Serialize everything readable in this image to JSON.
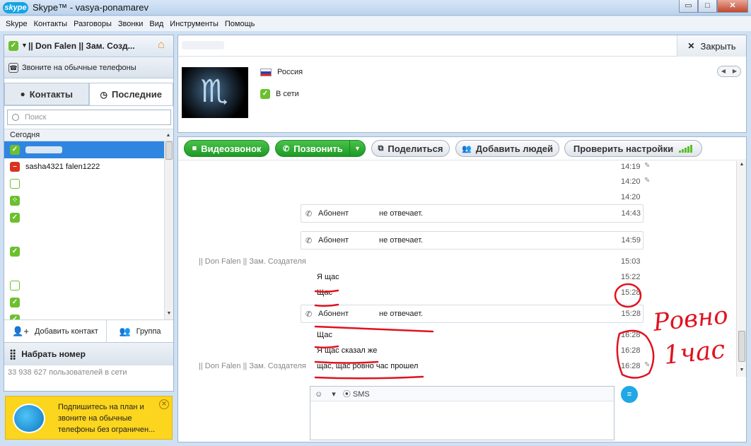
{
  "window": {
    "logo": "skype",
    "title": "Skype™ - vasya-ponamarev",
    "buttons": [
      "restore",
      "maximize",
      "close"
    ]
  },
  "menu": [
    "Skype",
    "Контакты",
    "Разговоры",
    "Звонки",
    "Вид",
    "Инструменты",
    "Помощь"
  ],
  "left": {
    "user_name": "|| Don Falen || Зам. Созд...",
    "phones_label": "Звоните на обычные телефоны",
    "tabs": [
      {
        "label": "Контакты"
      },
      {
        "label": "Последние"
      }
    ],
    "search_placeholder": "Поиск",
    "group_header": "Сегодня",
    "contacts": [
      {
        "name": "",
        "status": "online",
        "selected": true
      },
      {
        "name": "sasha4321 falen1222",
        "status": "busy"
      },
      {
        "name": "",
        "status": "offline"
      },
      {
        "name": "",
        "status": "away"
      },
      {
        "name": "",
        "status": "online"
      },
      {
        "name": "",
        "status": "online"
      },
      {
        "name": "",
        "status": "offline"
      },
      {
        "name": "",
        "status": "online"
      },
      {
        "name": "",
        "status": "online"
      },
      {
        "name": "",
        "status": "online"
      }
    ],
    "add_contact": "Добавить контакт",
    "group": "Группа",
    "dial": "Набрать номер",
    "online_count": "33 938 627 пользователей в сети"
  },
  "promo": {
    "text": "Подпишитесь на план и звоните на обычные телефоны без ограничен..."
  },
  "profile": {
    "close_label": "Закрыть",
    "country": "Россия",
    "status": "В сети"
  },
  "callbar": {
    "video": "Видеозвонок",
    "call": "Позвонить",
    "share": "Поделиться",
    "add_people": "Добавить людей",
    "check_settings": "Проверить настройки"
  },
  "messages": {
    "times_top": [
      "14:19",
      "14:20",
      "14:20"
    ],
    "sys1": {
      "a": "Абонент",
      "b": "не отвечает.",
      "time": "14:43"
    },
    "sys2": {
      "a": "Абонент",
      "b": "не отвечает.",
      "time": "14:59"
    },
    "sender": "|| Don Falen || Зам. Создателя",
    "sender_time": "15:03",
    "m1": {
      "text": "Я щас",
      "time": "15:22"
    },
    "m2": {
      "text": "Щас",
      "time": "15:28"
    },
    "sys3": {
      "a": "Абонент",
      "b": "не отвечает.",
      "time": "15:28"
    },
    "m3": {
      "text": "Щас",
      "time": "16:28"
    },
    "m4": {
      "text": "Я щас сказал же",
      "time": "16:28"
    },
    "sender2": "|| Don Falen || Зам. Создателя",
    "m5": {
      "text": "щас, щас  ровно час прошел",
      "time": "16:28"
    }
  },
  "compose": {
    "emoticon": "☺",
    "sms": "SMS"
  },
  "annotation": {
    "line1": "Ровно",
    "line2": "1час",
    "color": "#e0131f"
  }
}
